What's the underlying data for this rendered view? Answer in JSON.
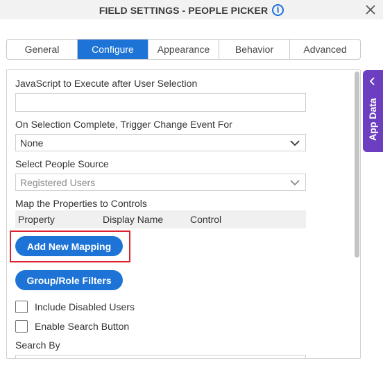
{
  "header": {
    "title": "FIELD SETTINGS - PEOPLE PICKER",
    "info_glyph": "i"
  },
  "tabs": [
    {
      "label": "General",
      "active": false
    },
    {
      "label": "Configure",
      "active": true
    },
    {
      "label": "Appearance",
      "active": false
    },
    {
      "label": "Behavior",
      "active": false
    },
    {
      "label": "Advanced",
      "active": false
    }
  ],
  "form": {
    "js_label": "JavaScript to Execute after User Selection",
    "js_value": "",
    "trigger_label": "On Selection Complete, Trigger Change Event For",
    "trigger_value": "None",
    "source_label": "Select People Source",
    "source_value": "Registered Users",
    "map_label": "Map the Properties to Controls",
    "map_columns": [
      "Property",
      "Display Name",
      "Control"
    ],
    "add_mapping_button": "Add New Mapping",
    "group_filters_button": "Group/Role Filters",
    "include_disabled_label": "Include Disabled Users",
    "include_disabled_checked": false,
    "enable_search_label": "Enable Search Button",
    "enable_search_checked": false,
    "search_by_label": "Search By"
  },
  "side_tab": {
    "label": "App Data"
  },
  "colors": {
    "accent": "#1e74d6",
    "side_tab": "#6b3fbf",
    "highlight": "#d9232e"
  }
}
